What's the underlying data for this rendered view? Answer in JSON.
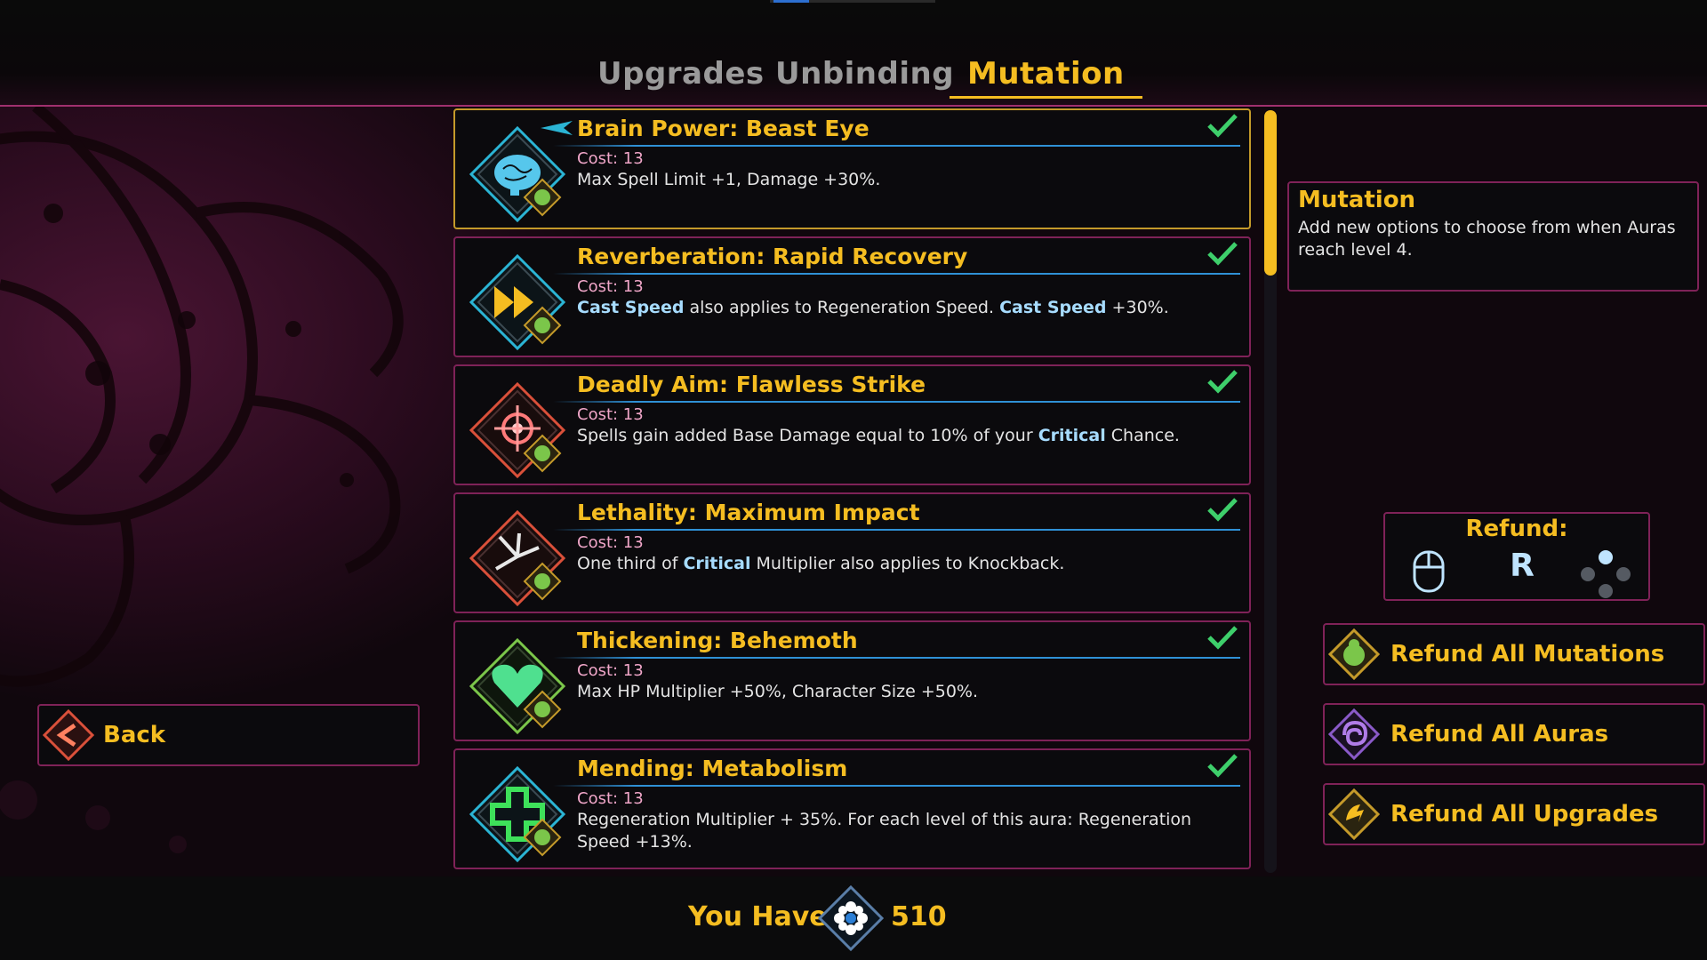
{
  "tabs": [
    {
      "label": "Upgrades",
      "active": false
    },
    {
      "label": "Unbinding",
      "active": false
    },
    {
      "label": "Mutation",
      "active": true
    }
  ],
  "mutations": [
    {
      "title": "Brain Power: Beast Eye",
      "cost": "Cost: 13",
      "desc": [
        {
          "t": "Max Spell Limit +1, Damage +30%."
        }
      ],
      "icon": "brain-icon",
      "color": "#2bb4d4",
      "checked": true,
      "selected": true
    },
    {
      "title": "Reverberation: Rapid Recovery",
      "cost": "Cost: 13",
      "desc": [
        {
          "t": "Cast Speed",
          "b": true
        },
        {
          "t": " also applies to Regeneration Speed. "
        },
        {
          "t": "Cast Speed",
          "b": true
        },
        {
          "t": " +30%."
        }
      ],
      "icon": "fast-forward-icon",
      "color": "#2bb4d4",
      "checked": true,
      "selected": false
    },
    {
      "title": "Deadly Aim: Flawless Strike",
      "cost": "Cost: 13",
      "desc": [
        {
          "t": "Spells gain added Base Damage equal to 10% of your "
        },
        {
          "t": "Critical",
          "b": true
        },
        {
          "t": " Chance."
        }
      ],
      "icon": "crosshair-burst-icon",
      "color": "#d9503a",
      "checked": true,
      "selected": false
    },
    {
      "title": "Lethality: Maximum Impact",
      "cost": "Cost: 13",
      "desc": [
        {
          "t": "One third of "
        },
        {
          "t": "Critical",
          "b": true
        },
        {
          "t": " Multiplier also applies to Knockback."
        }
      ],
      "icon": "shatter-icon",
      "color": "#d9503a",
      "checked": true,
      "selected": false
    },
    {
      "title": "Thickening: Behemoth",
      "cost": "Cost: 13",
      "desc": [
        {
          "t": "Max HP Multiplier +50%, Character Size +50%."
        }
      ],
      "icon": "heart-icon",
      "color": "#7bc64a",
      "checked": true,
      "selected": false
    },
    {
      "title": "Mending: Metabolism",
      "cost": "Cost: 13",
      "desc": [
        {
          "t": "Regeneration Multiplier + 35%. For each level of this aura: Regeneration Speed +13%."
        }
      ],
      "icon": "medical-cross-icon",
      "color": "#2bb4d4",
      "checked": true,
      "selected": false
    }
  ],
  "info": {
    "title": "Mutation",
    "text": "Add new options to choose from when Auras reach level 4."
  },
  "refund": {
    "title": "Refund:",
    "key": "R"
  },
  "buttons": {
    "refund_mutations": "Refund All Mutations",
    "refund_auras": "Refund All Auras",
    "refund_upgrades": "Refund All Upgrades",
    "back": "Back"
  },
  "currency": {
    "label": "You Have",
    "value": "510"
  },
  "colors": {
    "accent": "#f5bd21",
    "border": "#7f2258",
    "keyword": "#a7dcff",
    "check": "#3ecf6b"
  }
}
